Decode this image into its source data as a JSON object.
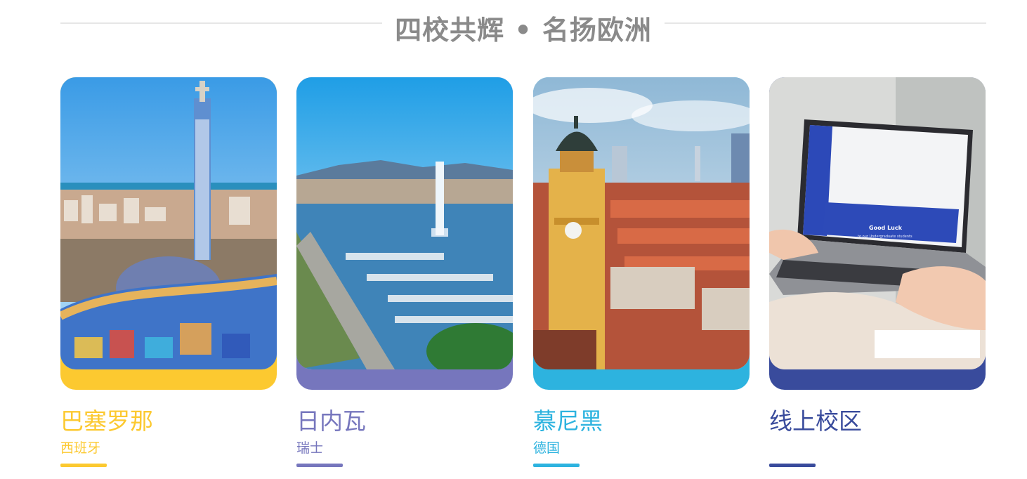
{
  "header": {
    "title": "四校共辉 • 名扬欧洲"
  },
  "campuses": [
    {
      "city": "巴塞罗那",
      "country": "西班牙",
      "color": "#fcc930",
      "photo": "park-guell-barcelona"
    },
    {
      "city": "日内瓦",
      "country": "瑞士",
      "color": "#7676bd",
      "photo": "geneva-lake-fountain"
    },
    {
      "city": "慕尼黑",
      "country": "德国",
      "color": "#2db3df",
      "photo": "munich-theatine-church"
    },
    {
      "city": "线上校区",
      "country": "",
      "color": "#394b9c",
      "photo": "laptop-online-class"
    }
  ],
  "laptop_screen": {
    "banner": "Good Luck",
    "banner_sub": "to our Undergraduate students"
  }
}
